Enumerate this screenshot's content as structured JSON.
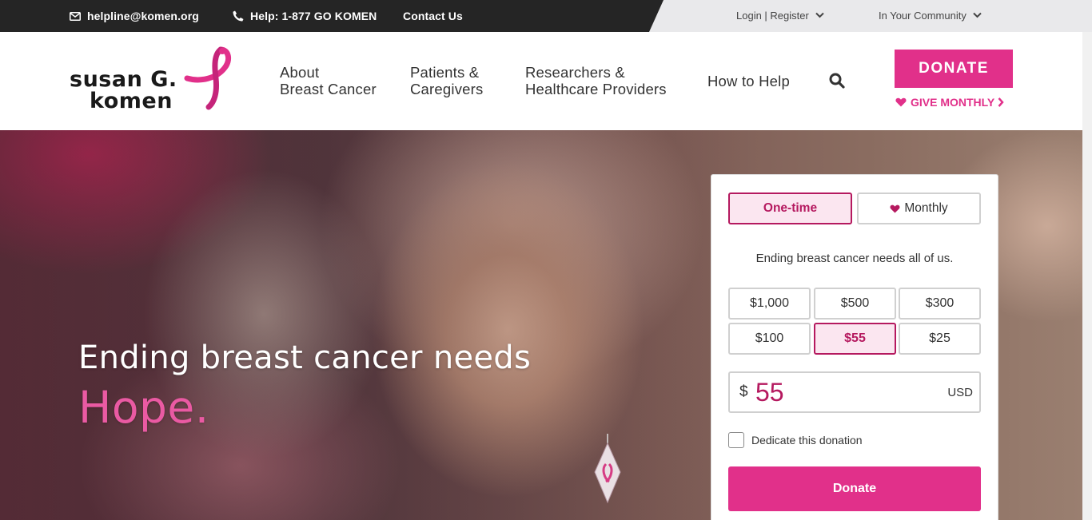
{
  "topbar": {
    "email": "helpline@komen.org",
    "phone": "Help: 1-877 GO KOMEN",
    "contact": "Contact Us",
    "login": "Login | Register",
    "community": "In Your Community"
  },
  "logo": {
    "line1": "susan G.",
    "line2": "komen"
  },
  "nav": {
    "item1_line1": "About",
    "item1_line2": "Breast Cancer",
    "item2_line1": "Patients &",
    "item2_line2": "Caregivers",
    "item3_line1": "Researchers &",
    "item3_line2": "Healthcare Providers",
    "item4": "How to Help",
    "donate": "DONATE",
    "give_monthly": "GIVE MONTHLY"
  },
  "hero": {
    "title": "Ending breast cancer needs",
    "highlight": "Hope."
  },
  "donation_form": {
    "one_time": "One-time",
    "monthly": "Monthly",
    "selected_frequency": "One-time",
    "tagline": "Ending breast cancer needs all of us.",
    "amounts": [
      "$1,000",
      "$500",
      "$300",
      "$100",
      "$55",
      "$25"
    ],
    "selected_amount": "$55",
    "currency_symbol": "$",
    "custom_amount": "55",
    "currency_code": "USD",
    "dedicate_label": "Dedicate this donation",
    "dedicate_checked": false,
    "submit_label": "Donate"
  },
  "colors": {
    "brand_pink": "#e1308a",
    "brand_dark_pink": "#b5195f",
    "hope_pink": "#ea5aa3",
    "topbar_dark": "#252525"
  }
}
